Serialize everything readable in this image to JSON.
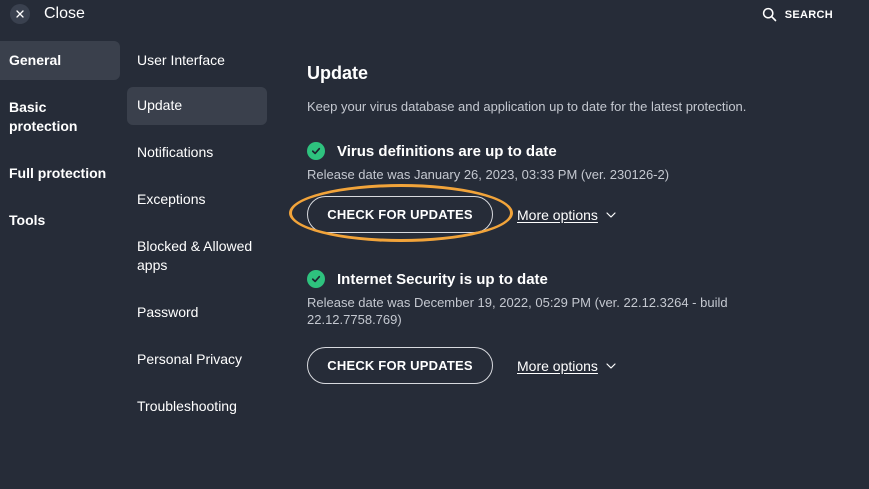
{
  "topbar": {
    "close_label": "Close",
    "search_label": "SEARCH"
  },
  "categories": [
    {
      "label": "General",
      "active": true
    },
    {
      "label": "Basic protection",
      "active": false
    },
    {
      "label": "Full protection",
      "active": false
    },
    {
      "label": "Tools",
      "active": false
    }
  ],
  "subnav": [
    {
      "label": "User Interface",
      "active": false
    },
    {
      "label": "Update",
      "active": true
    },
    {
      "label": "Notifications",
      "active": false
    },
    {
      "label": "Exceptions",
      "active": false
    },
    {
      "label": "Blocked & Allowed apps",
      "active": false
    },
    {
      "label": "Password",
      "active": false
    },
    {
      "label": "Personal Privacy",
      "active": false
    },
    {
      "label": "Troubleshooting",
      "active": false
    }
  ],
  "main": {
    "title": "Update",
    "description": "Keep your virus database and application up to date for the latest protection.",
    "sections": [
      {
        "status": "Virus definitions are up to date",
        "release": "Release date was January 26, 2023, 03:33 PM (ver. 230126-2)",
        "button_label": "CHECK FOR UPDATES",
        "more_label": "More options",
        "highlighted": true
      },
      {
        "status": "Internet Security is up to date",
        "release": "Release date was December 19, 2022, 05:29 PM (ver. 22.12.3264 - build 22.12.7758.769)",
        "button_label": "CHECK FOR UPDATES",
        "more_label": "More options",
        "highlighted": false
      }
    ]
  },
  "colors": {
    "background": "#262c38",
    "active_item": "#3a404c",
    "status_ok": "#2ec27e",
    "highlight": "#f2a43a"
  }
}
